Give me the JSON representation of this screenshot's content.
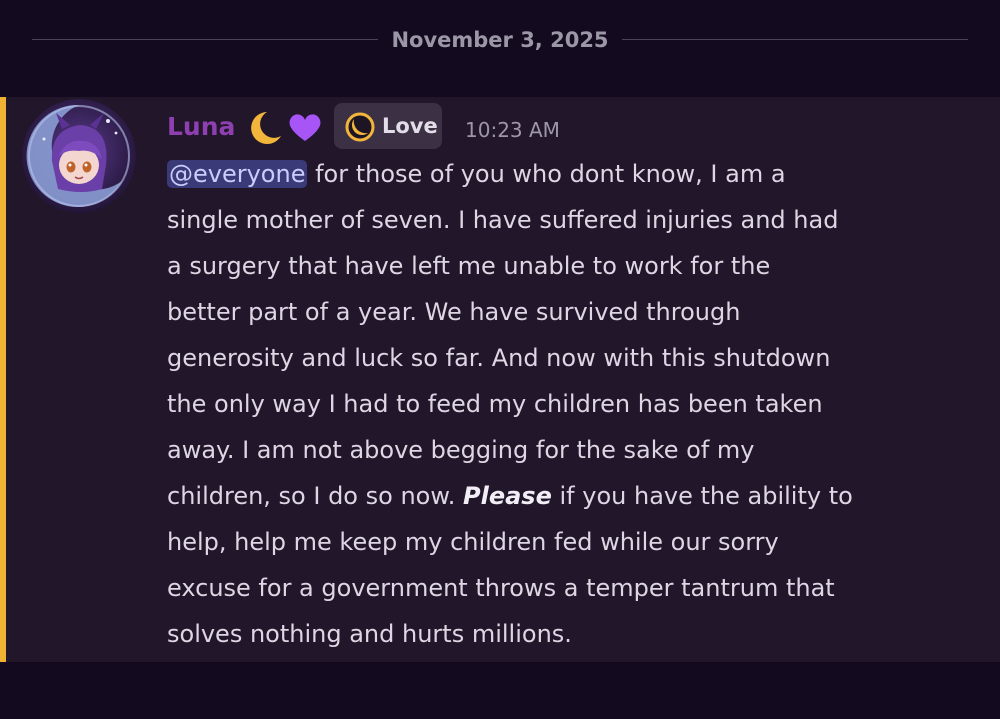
{
  "date_divider": {
    "label": "November 3, 2025"
  },
  "message": {
    "author": {
      "name": "Luna",
      "name_emoji_icons": [
        "crescent-moon-icon",
        "purple-heart-icon"
      ],
      "name_color": "#8e3fb0"
    },
    "role_tag": {
      "icon": "crescent-moon-icon",
      "label": "Love"
    },
    "timestamp": "10:23 AM",
    "highlight_color": "#f0b232",
    "body": {
      "mention": "@everyone",
      "line1_rest": " for those of you who dont know, I am a",
      "line2": "single mother of seven. I have suffered injuries and had",
      "line3": "a surgery that have left me unable to work for the",
      "line4": "better part of a year. We have survived through",
      "line5": "generosity and luck so far. And now with this shutdown",
      "line6": "the only way I had to feed my children has been taken",
      "line7": "away. I am not above begging for the sake of my",
      "line8_start": "children, so I do so now. ",
      "line8_emph": "Please",
      "line8_end": " if you have the ability to",
      "line9": "help, help me keep my children fed while our sorry",
      "line10": "excuse for a government throws a temper tantrum  that",
      "line11": "solves nothing and hurts millions."
    }
  }
}
